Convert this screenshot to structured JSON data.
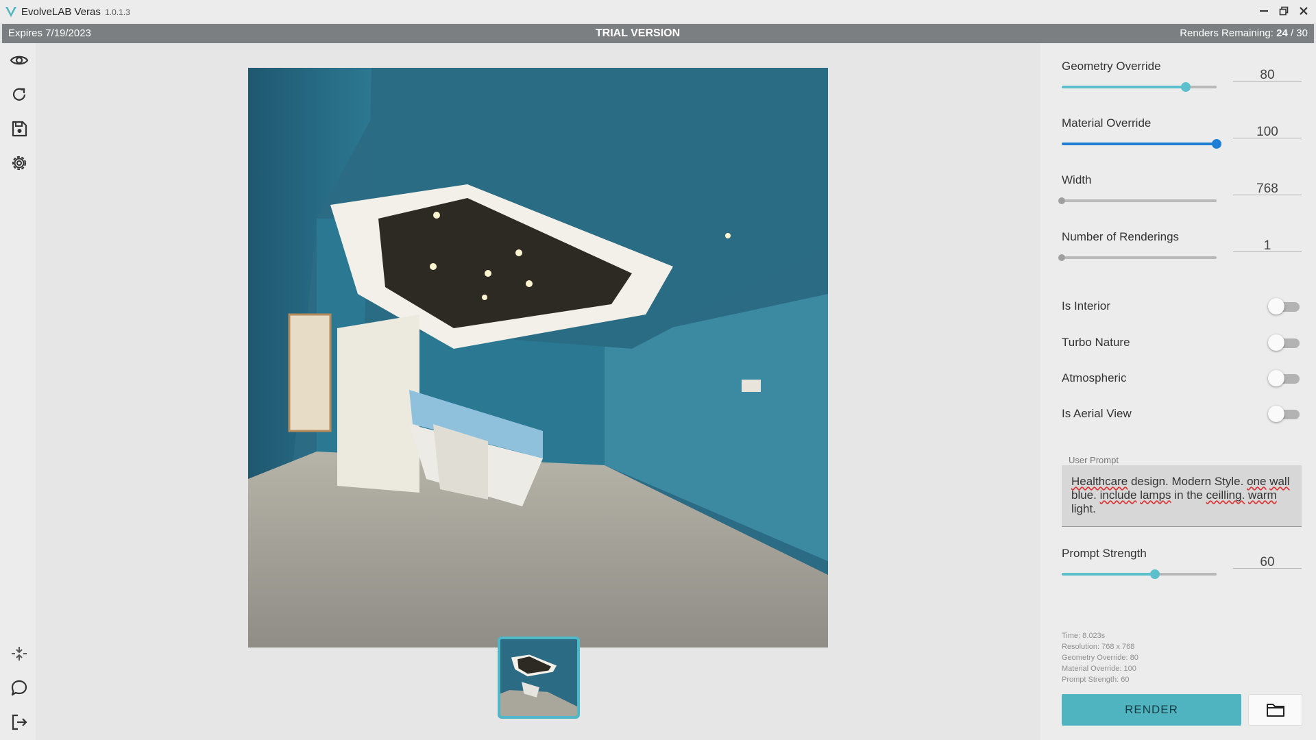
{
  "window": {
    "app_name": "EvolveLAB Veras",
    "version": "1.0.1.3",
    "minimize_icon": "minimize-icon",
    "restore_icon": "restore-icon",
    "close_icon": "close-icon"
  },
  "trial_bar": {
    "expires": "Expires 7/19/2023",
    "title": "TRIAL VERSION",
    "renders_label": "Renders Remaining:",
    "renders_value": "24",
    "renders_total": "/ 30"
  },
  "toolbar": {
    "top_tools": [
      "eye-icon",
      "refresh-icon",
      "save-icon",
      "gear-icon"
    ],
    "bottom_tools": [
      "collapse-icon",
      "chat-icon",
      "logout-icon"
    ]
  },
  "settings": {
    "geometry_override": {
      "label": "Geometry Override",
      "value": "80",
      "level": 0.8,
      "color": "#5bbfcc"
    },
    "material_override": {
      "label": "Material Override",
      "value": "100",
      "level": 1.0,
      "color": "#1f7fd6"
    },
    "width": {
      "label": "Width",
      "value": "768",
      "level": 0.0
    },
    "num_renderings": {
      "label": "Number of Renderings",
      "value": "1",
      "level": 0.0
    },
    "toggles": [
      {
        "label": "Is Interior",
        "on": false
      },
      {
        "label": "Turbo Nature",
        "on": false
      },
      {
        "label": "Atmospheric",
        "on": false
      },
      {
        "label": "Is Aerial View",
        "on": false
      }
    ],
    "user_prompt": {
      "label": "User Prompt",
      "text": "Healthcare design. Modern Style. one wall blue. include lamps in the ceilling. warm light."
    },
    "prompt_strength": {
      "label": "Prompt Strength",
      "value": "60",
      "level": 0.6,
      "color": "#5bbfcc"
    }
  },
  "render_info": {
    "time": "Time: 8.023s",
    "resolution": "Resolution: 768 x 768",
    "geometry": "Geometry Override: 80",
    "material": "Material Override: 100",
    "prompt": "Prompt Strength: 60"
  },
  "actions": {
    "render_label": "RENDER",
    "folder_icon": "folder-icon"
  }
}
